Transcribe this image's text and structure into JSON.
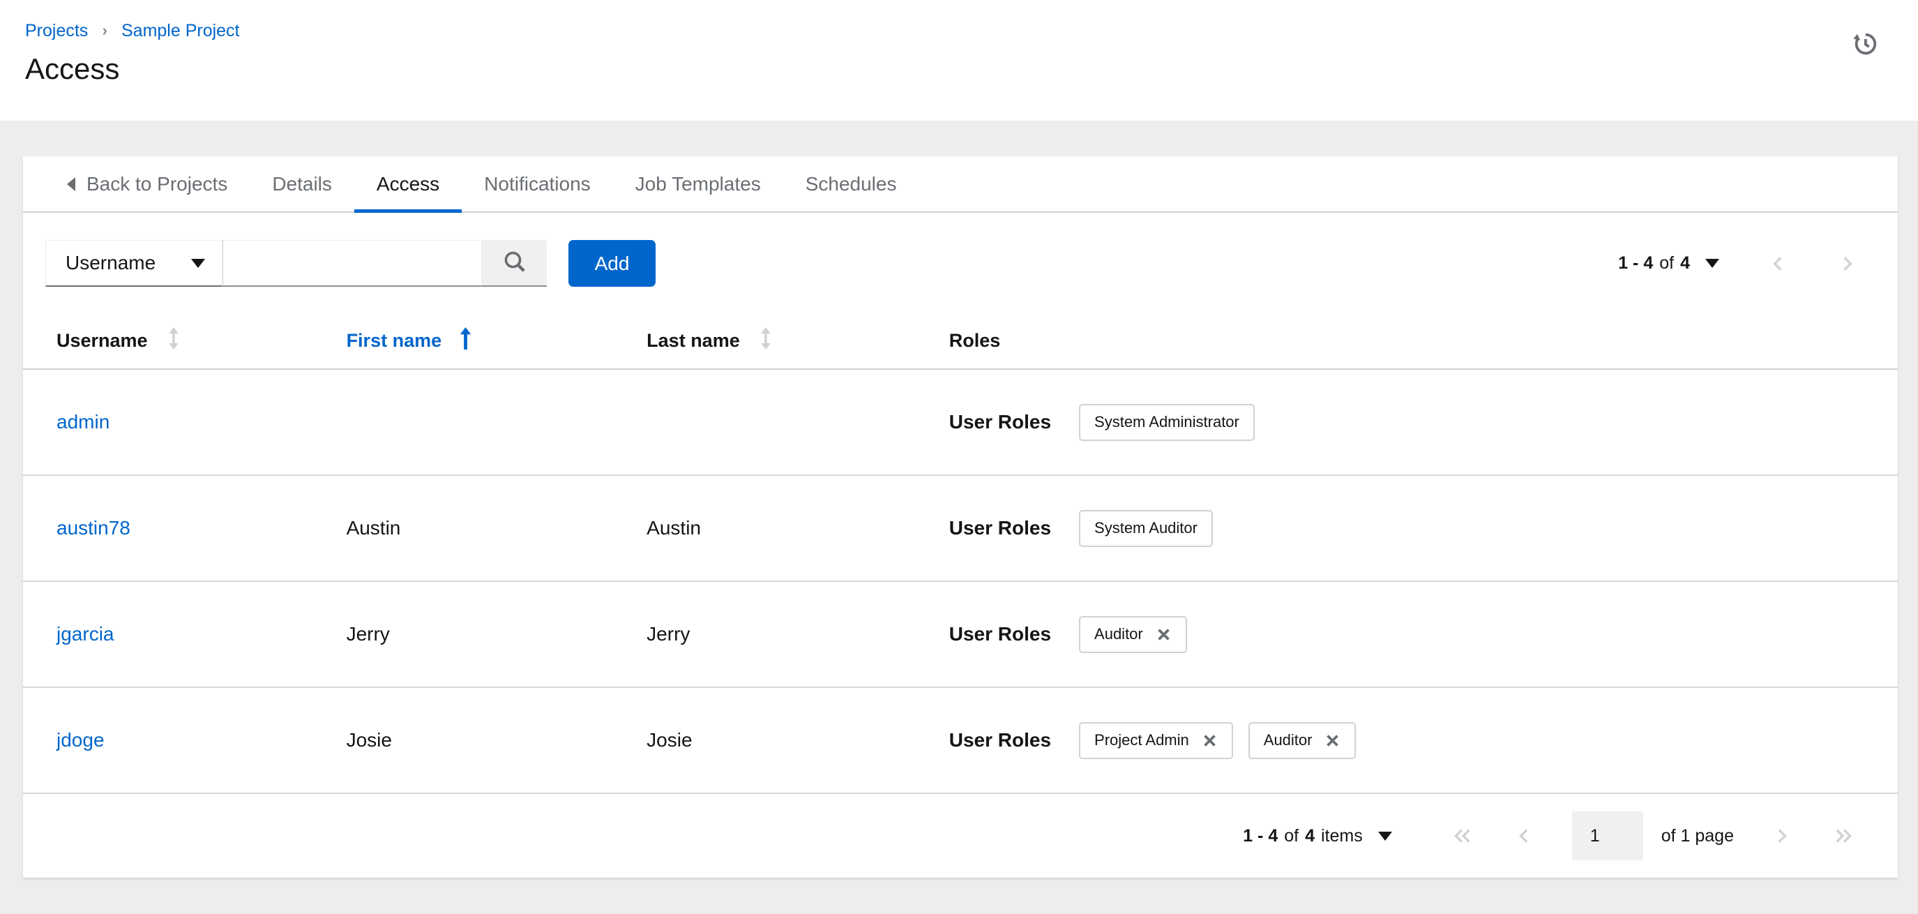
{
  "colors": {
    "accent_blue": "#0066cc",
    "text_dark": "#151515",
    "text_gray": "#6a6e73",
    "disabled_gray": "#d2d2d2",
    "page_background": "#ededed",
    "control_gray_background": "#f0f0f0"
  },
  "icons": {
    "history": "clock-rewind-arrow",
    "breadcrumb_separator": "›",
    "back_caret": "◂",
    "caret_down": "▾",
    "search": "magnifier",
    "sort_inactive": "↕",
    "sort_ascending": "↑",
    "prev": "‹",
    "next": "›",
    "first": "«",
    "last": "»",
    "remove_chip": "✕"
  },
  "breadcrumb": {
    "items": [
      "Projects",
      "Sample Project"
    ]
  },
  "page": {
    "title": "Access"
  },
  "tabs": {
    "back_label": "Back to Projects",
    "items": [
      {
        "label": "Details",
        "active": false
      },
      {
        "label": "Access",
        "active": true
      },
      {
        "label": "Notifications",
        "active": false
      },
      {
        "label": "Job Templates",
        "active": false
      },
      {
        "label": "Schedules",
        "active": false
      }
    ]
  },
  "toolbar": {
    "filter_selected": "Username",
    "search_value": "",
    "add_label": "Add",
    "pagination": {
      "range": "1 - 4",
      "of": "of",
      "total": "4"
    }
  },
  "table": {
    "headers": {
      "username": "Username",
      "first_name": "First name",
      "last_name": "Last name",
      "roles": "Roles"
    },
    "sorted_column": "First name",
    "sort_direction": "ascending",
    "roles_row_label": "User Roles",
    "rows": [
      {
        "username": "admin",
        "first_name": "",
        "last_name": "",
        "roles": [
          {
            "name": "System Administrator",
            "removable": false
          }
        ]
      },
      {
        "username": "austin78",
        "first_name": "Austin",
        "last_name": "Austin",
        "roles": [
          {
            "name": "System Auditor",
            "removable": false
          }
        ]
      },
      {
        "username": "jgarcia",
        "first_name": "Jerry",
        "last_name": "Jerry",
        "roles": [
          {
            "name": "Auditor",
            "removable": true
          }
        ]
      },
      {
        "username": "jdoge",
        "first_name": "Josie",
        "last_name": "Josie",
        "roles": [
          {
            "name": "Project Admin",
            "removable": true
          },
          {
            "name": "Auditor",
            "removable": true
          }
        ]
      }
    ]
  },
  "footer": {
    "items_range": "1 - 4",
    "of": "of",
    "total": "4",
    "items_label": "items",
    "page_value": "1",
    "page_of_label": "of 1 page"
  }
}
